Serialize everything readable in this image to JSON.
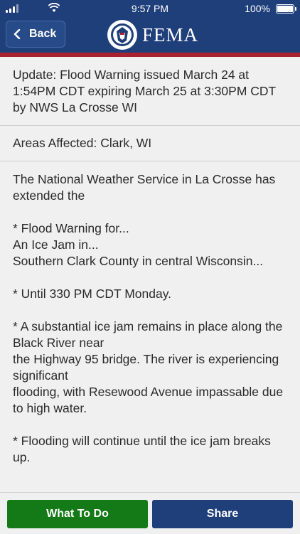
{
  "status_bar": {
    "time": "9:57 PM",
    "battery": "100%"
  },
  "nav": {
    "back_label": "Back",
    "brand": "FEMA"
  },
  "alert": {
    "update": "Update: Flood Warning issued March 24 at 1:54PM CDT expiring March 25 at 3:30PM CDT by NWS La Crosse WI",
    "areas": "Areas Affected: Clark, WI",
    "body": "The National Weather Service in La Crosse has extended the\n\n* Flood Warning for...\nAn Ice Jam in...\nSouthern Clark County in central Wisconsin...\n\n* Until 330 PM CDT Monday.\n\n* A substantial ice jam remains in place along the Black River near\nthe Highway 95 bridge. The river is experiencing significant\nflooding, with Resewood Avenue impassable due to high water.\n\n* Flooding will continue until the ice jam breaks up."
  },
  "actions": {
    "what_to_do": "What To Do",
    "share": "Share"
  },
  "colors": {
    "navy": "#1f3f7a",
    "red_stripe": "#a8232f",
    "green": "#137a17"
  },
  "icons": [
    "signal-icon",
    "wifi-icon",
    "battery-icon",
    "chevron-left-icon",
    "dhs-seal-icon"
  ]
}
